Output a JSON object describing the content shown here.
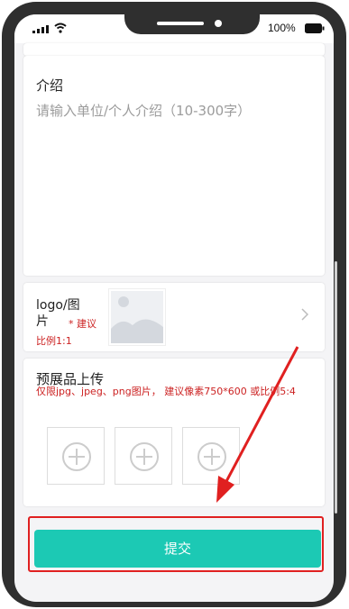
{
  "status_bar": {
    "battery_percent": "100%"
  },
  "intro": {
    "title": "介绍",
    "placeholder": "请输入单位/个人介绍（10-300字）"
  },
  "logo": {
    "label": "logo/图片",
    "required_mark": "* 建议",
    "hint": "比例1:1"
  },
  "upload": {
    "title": "预展品上传",
    "hint": "仅限jpg、jpeg、png图片， 建议像素750*600 或比例5:4",
    "slots": [
      "add-image",
      "add-image",
      "add-image"
    ]
  },
  "submit": {
    "label": "提交"
  },
  "colors": {
    "accent": "#1cc9b4",
    "annotation": "#e02020",
    "hint_red": "#cc2222"
  }
}
